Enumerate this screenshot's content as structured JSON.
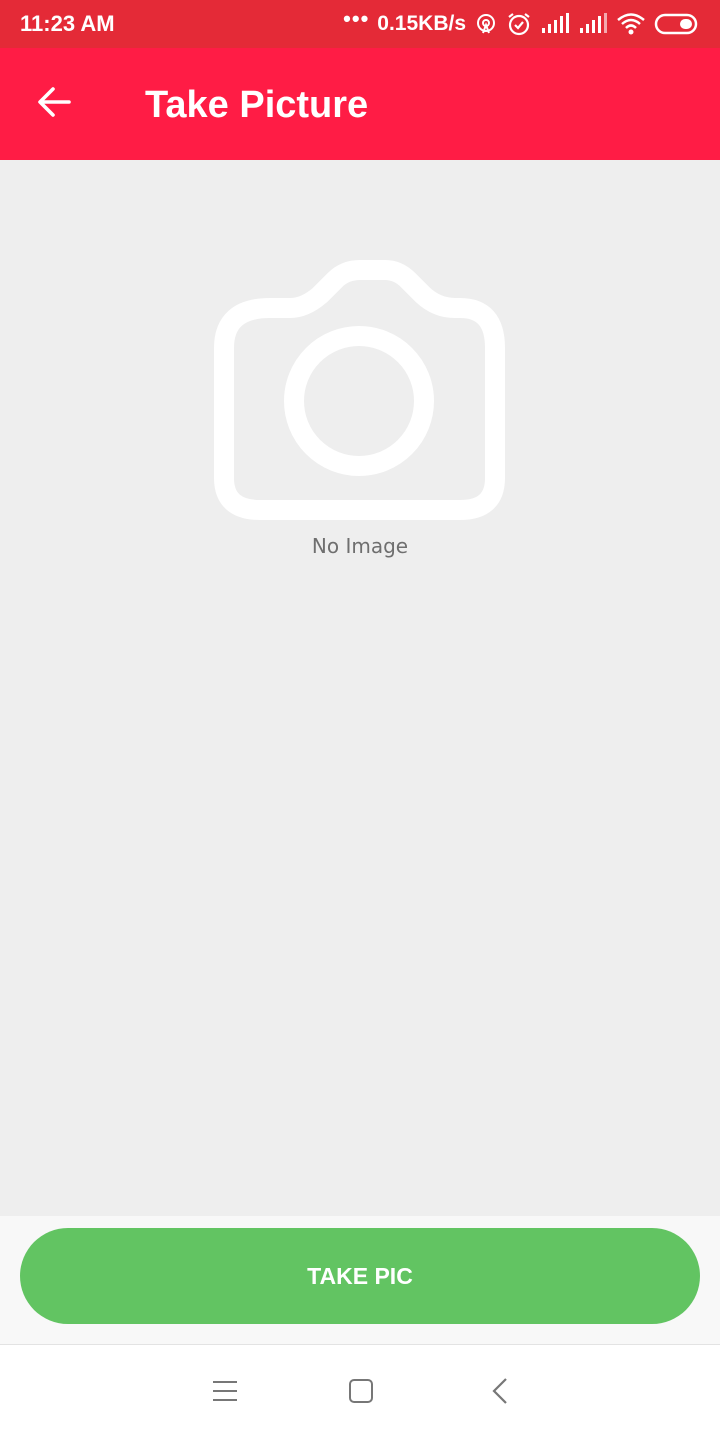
{
  "status_bar": {
    "time": "11:23 AM",
    "dots": "•••",
    "network_speed": "0.15KB/s",
    "icons": [
      "hotspot-icon",
      "alarm-icon",
      "signal-icon",
      "signal-icon",
      "wifi-icon",
      "battery-icon"
    ]
  },
  "app_bar": {
    "title": "Take Picture",
    "back_icon": "arrow-left-icon",
    "background_color": "#ff1c45"
  },
  "content": {
    "placeholder_icon": "camera-icon",
    "placeholder_text": "No Image",
    "background_color": "#eeeeee"
  },
  "action": {
    "take_pic_label": "TAKE PIC",
    "button_color": "#62c462"
  },
  "nav_bar": {
    "buttons": [
      "menu-icon",
      "home-icon",
      "back-icon"
    ]
  }
}
